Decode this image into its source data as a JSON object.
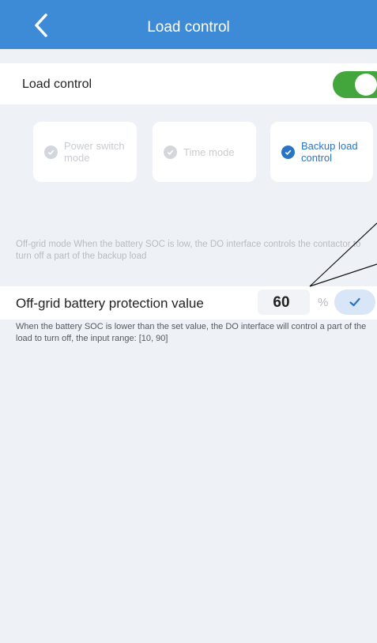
{
  "header": {
    "title": "Load control"
  },
  "load_control": {
    "label": "Load control",
    "enabled": true
  },
  "modes": [
    {
      "label": "Power switch mode",
      "selected": false
    },
    {
      "label": "Time mode",
      "selected": false
    },
    {
      "label": "Backup load control",
      "selected": true
    }
  ],
  "offgrid_description": "Off-grid mode When the battery SOC is low, the DO interface controls the contactor to turn off a part of the backup load",
  "protection": {
    "label": "Off-grid battery protection value",
    "value": "60",
    "unit": "%",
    "description": "When the battery SOC is lower than the set value, the DO interface will control a part of the load to turn off, the input range: [10, 90]"
  },
  "colors": {
    "header": "#3d8bd6",
    "accent": "#2a74c8",
    "toggle_on": "#43a63d"
  }
}
